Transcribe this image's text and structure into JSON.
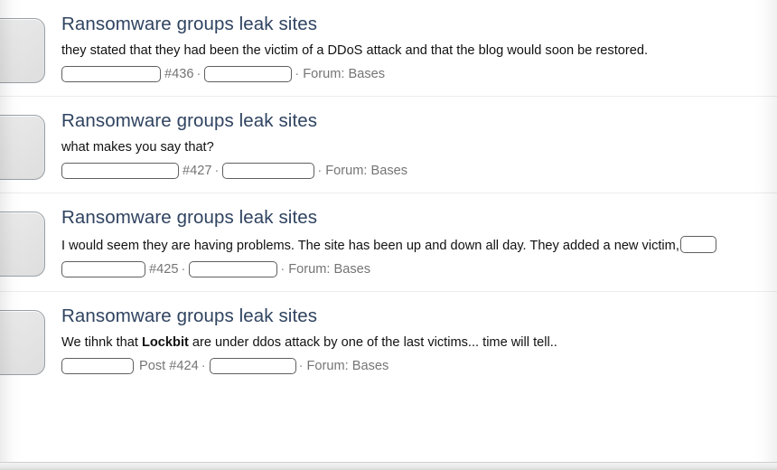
{
  "theme": {
    "title_color": "#2f4360",
    "body_text_color": "#111111",
    "meta_text_color": "#757575",
    "separator_color": "#ececec",
    "redaction_border_color": "#5f5f5f",
    "avatar_border_color": "#9aa0a6",
    "page_background": "#ffffff"
  },
  "list": {
    "posts": [
      {
        "avatar_label": "avatar-placeholder",
        "title": "Ransomware groups leak sites",
        "snippet_prefix": "they stated that they had been the victim of a DDoS attack and that the blog would soon be restored.",
        "snippet_bold": "",
        "snippet_suffix": "",
        "snippet_trailing_redaction": false,
        "meta": {
          "author_redaction_width": 110,
          "post_number": "#436",
          "separator": "·",
          "date_redaction_width": 97,
          "forum_label": "Forum: Bases"
        }
      },
      {
        "avatar_label": "avatar-placeholder",
        "title": "Ransomware groups leak sites",
        "snippet_prefix": "what makes you say that?",
        "snippet_bold": "",
        "snippet_suffix": "",
        "snippet_trailing_redaction": false,
        "meta": {
          "author_redaction_width": 130,
          "post_number": "#427",
          "separator": "·",
          "date_redaction_width": 102,
          "forum_label": "Forum: Bases"
        }
      },
      {
        "avatar_label": "avatar-placeholder",
        "title": "Ransomware groups leak sites",
        "snippet_prefix": "I would seem they are having problems. The site has been up and down all day. They added a new victim,",
        "snippet_bold": "",
        "snippet_suffix": "",
        "snippet_trailing_redaction": true,
        "meta": {
          "author_redaction_width": 93,
          "post_number": "#425",
          "separator": "·",
          "date_redaction_width": 98,
          "forum_label": "Forum: Bases"
        }
      },
      {
        "avatar_label": "avatar-placeholder",
        "title": "Ransomware groups leak sites",
        "snippet_prefix": "We tihnk that ",
        "snippet_bold": "Lockbit",
        "snippet_suffix": " are under ddos attack by one of the last victims... time will tell..",
        "snippet_trailing_redaction": false,
        "meta": {
          "author_redaction_width": 80,
          "post_number": "Post #424",
          "separator": "·",
          "date_redaction_width": 96,
          "forum_label": "Forum: Bases"
        }
      }
    ]
  }
}
